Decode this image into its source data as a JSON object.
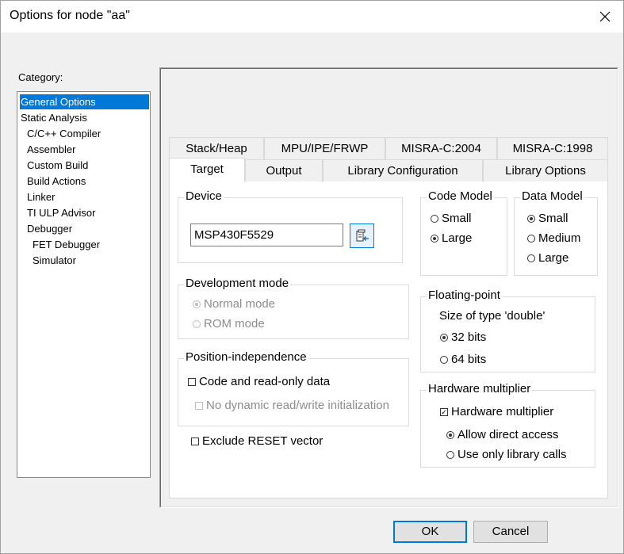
{
  "window": {
    "title": "Options for node \"aa\""
  },
  "category": {
    "label": "Category:",
    "items": [
      "General Options",
      "Static Analysis",
      "C/C++ Compiler",
      "Assembler",
      "Custom Build",
      "Build Actions",
      "Linker",
      "TI ULP Advisor",
      "Debugger",
      "FET Debugger",
      "Simulator"
    ],
    "selected": "General Options"
  },
  "tabs": {
    "row1": [
      "Stack/Heap",
      "MPU/IPE/FRWP",
      "MISRA-C:2004",
      "MISRA-C:1998"
    ],
    "row2": [
      "Target",
      "Output",
      "Library Configuration",
      "Library Options"
    ],
    "active": "Target"
  },
  "device": {
    "title": "Device",
    "value": "MSP430F5529",
    "picker_icon": "device-picker-icon"
  },
  "code_model": {
    "title": "Code Model",
    "options": [
      "Small",
      "Large"
    ],
    "selected": "Large"
  },
  "data_model": {
    "title": "Data Model",
    "options": [
      "Small",
      "Medium",
      "Large"
    ],
    "selected": "Small"
  },
  "dev_mode": {
    "title": "Development mode",
    "options": [
      "Normal mode",
      "ROM mode"
    ],
    "selected": "Normal mode",
    "enabled": false
  },
  "floating": {
    "title": "Floating-point",
    "label": "Size of type 'double'",
    "options": [
      "32 bits",
      "64 bits"
    ],
    "selected": "32 bits"
  },
  "position": {
    "title": "Position-independence",
    "code_ro": "Code and read-only data",
    "code_ro_checked": false,
    "no_dyn": "No dynamic read/write initialization",
    "no_dyn_checked": false,
    "no_dyn_enabled": false
  },
  "exclude_reset": {
    "label": "Exclude RESET vector",
    "checked": false
  },
  "hw_mult": {
    "title": "Hardware multiplier",
    "check_label": "Hardware multiplier",
    "checked": true,
    "options": [
      "Allow direct access",
      "Use only library calls"
    ],
    "selected": "Allow direct access"
  },
  "buttons": {
    "ok": "OK",
    "cancel": "Cancel"
  },
  "colors": {
    "selection": "#0078d7",
    "disabled_text": "#8c8c8c"
  }
}
